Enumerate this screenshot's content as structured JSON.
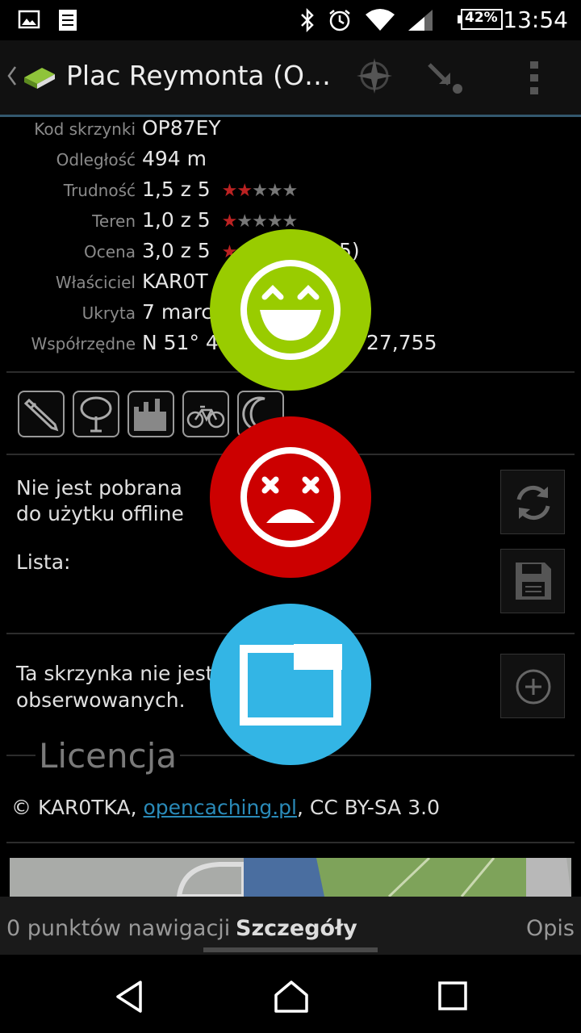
{
  "status_bar": {
    "time": "13:54",
    "battery": "42%",
    "icons": [
      "image-icon",
      "checklist-icon",
      "bluetooth-icon",
      "alarm-icon",
      "wifi-icon",
      "signal-icon",
      "battery-icon"
    ]
  },
  "action_bar": {
    "title": "Plac Reymonta (O…",
    "icons": [
      "back-icon",
      "cache-book-icon",
      "compass-icon",
      "navigate-icon",
      "overflow-menu-icon"
    ]
  },
  "details": {
    "code": {
      "label": "Kod skrzynki",
      "value": "OP87EY"
    },
    "distance": {
      "label": "Odległość",
      "value": "494 m"
    },
    "difficulty": {
      "label": "Trudność",
      "value": "1,5 z 5",
      "rating": 1.5
    },
    "terrain": {
      "label": "Teren",
      "value": "1,0 z 5",
      "rating": 1.0
    },
    "rating": {
      "label": "Ocena",
      "value": "3,0 z 5",
      "rating_value": 3.0,
      "count_suffix": "5)"
    },
    "owner": {
      "label": "Właściciel",
      "value": "KAR0T"
    },
    "hidden": {
      "label": "Ukryta",
      "value": "7 marc"
    },
    "coords": {
      "label": "Współrzędne",
      "value_left": "N 51° 4",
      "value_right": "27,755"
    }
  },
  "attributes": [
    "pencil-icon",
    "tree-icon",
    "castle-icon",
    "bicycle-icon",
    "moon-icon"
  ],
  "offline": {
    "line1": "Nie jest pobrana",
    "line2": "do użytku offline",
    "list_label": "Lista:"
  },
  "watch": {
    "line1": "Ta skrzynka nie jest",
    "line2": "obserwowanych."
  },
  "license": {
    "heading": "Licencja",
    "prefix": "© KAR0TKA, ",
    "link": "opencaching.pl",
    "suffix": ", CC BY-SA 3.0"
  },
  "tabs": {
    "left": "0 punktów nawigacji",
    "active": "Szczegóły",
    "right": "Opis"
  },
  "overlay": {
    "colors": {
      "happy": "#99cc00",
      "sad": "#cc0000",
      "window": "#33b5e5"
    }
  }
}
